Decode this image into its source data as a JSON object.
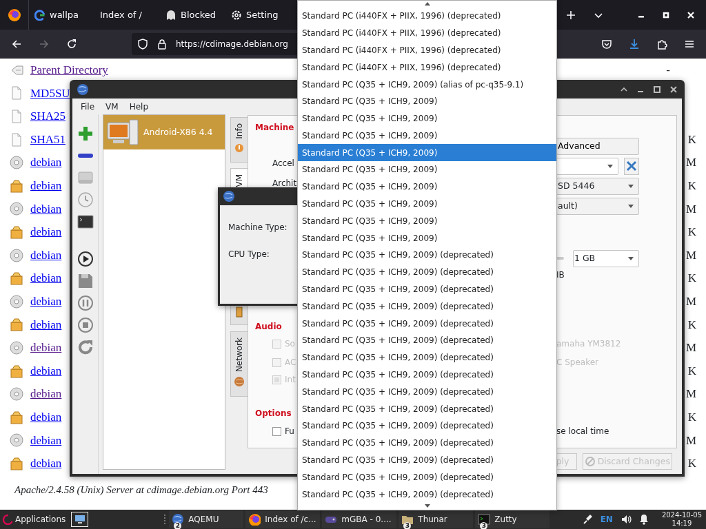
{
  "browser": {
    "tabs": [
      {
        "kind": "search",
        "label": "wallpa"
      },
      {
        "kind": "page",
        "label": "Index of /"
      },
      {
        "kind": "blocked",
        "label": "Blocked"
      },
      {
        "kind": "settings",
        "label": "Setting"
      }
    ],
    "url": "https://cdimage.debian.org"
  },
  "listing": {
    "rows": [
      {
        "kind": "parent",
        "name": "Parent Directory",
        "visited": true,
        "size": "-"
      },
      {
        "kind": "text",
        "name": "MD5SU",
        "visited": false
      },
      {
        "kind": "text",
        "name": "SHA25",
        "visited": false
      },
      {
        "kind": "text",
        "name": "SHA51",
        "visited": false,
        "size": "K"
      },
      {
        "kind": "disc",
        "name": "debian",
        "visited": false,
        "size": "M"
      },
      {
        "kind": "package",
        "name": "debian",
        "visited": false,
        "size": "K"
      },
      {
        "kind": "disc",
        "name": "debian",
        "visited": false,
        "size": "M"
      },
      {
        "kind": "package",
        "name": "debian",
        "visited": false,
        "size": "K"
      },
      {
        "kind": "disc",
        "name": "debian",
        "visited": false,
        "size": "M"
      },
      {
        "kind": "package",
        "name": "debian",
        "visited": false,
        "size": "K"
      },
      {
        "kind": "disc",
        "name": "debian",
        "visited": false,
        "size": "M"
      },
      {
        "kind": "package",
        "name": "debian",
        "visited": false,
        "size": "K"
      },
      {
        "kind": "disc",
        "name": "debian",
        "visited": true,
        "size": "M"
      },
      {
        "kind": "package",
        "name": "debian",
        "visited": false,
        "size": "K"
      },
      {
        "kind": "disc",
        "name": "debian",
        "visited": true,
        "size": "M"
      },
      {
        "kind": "package",
        "name": "debian",
        "visited": false,
        "size": "K"
      },
      {
        "kind": "disc",
        "name": "debian",
        "visited": false,
        "size": "M"
      },
      {
        "kind": "package",
        "name": "debian",
        "visited": false,
        "size": "K"
      }
    ],
    "footer": "Apache/2.4.58 (Unix) Server at cdimage.debian.org Port 443"
  },
  "qemu": {
    "menu": [
      "File",
      "VM",
      "Help"
    ],
    "toolbar": [
      {
        "kind": "add"
      },
      {
        "kind": "remove"
      },
      {
        "kind": "drive"
      },
      {
        "kind": "clock"
      },
      {
        "kind": "terminal"
      },
      {
        "kind": "play"
      },
      {
        "kind": "save"
      },
      {
        "kind": "pause"
      },
      {
        "kind": "stop"
      },
      {
        "kind": "reset"
      }
    ],
    "vms": [
      {
        "name": "Android-X86 4.4",
        "selected": true
      }
    ],
    "tabs": [
      {
        "kind": "info",
        "label": "Info",
        "selected": false
      },
      {
        "kind": "plain",
        "label": "VM",
        "selected": true
      },
      {
        "kind": "device",
        "selected": false
      },
      {
        "kind": "network",
        "label": "Network",
        "selected": false
      }
    ],
    "sections": [
      {
        "title": "Machine",
        "rows": [
          {
            "kind": "button",
            "value": "Advanced"
          },
          {
            "kind": "combo-tool",
            "label": "Accel"
          },
          {
            "kind": "combo",
            "label": "Archit",
            "value": "SD 5446"
          },
          {
            "kind": "combo",
            "value": "ault)"
          },
          {
            "kind": "slider-combo",
            "value": "1 GB"
          },
          {
            "kind": "note",
            "value": "IB"
          }
        ]
      },
      {
        "title": "Audio",
        "rows": [
          {
            "kind": "checks",
            "items": [
              {
                "label": "So",
                "checked": false,
                "disabled": true
              },
              {
                "label": "amaha YM3812",
                "disabled": true
              }
            ]
          },
          {
            "kind": "checks",
            "items": [
              {
                "label": "AC",
                "checked": false,
                "disabled": true
              },
              {
                "label": "C Speaker",
                "disabled": true
              }
            ]
          },
          {
            "kind": "checks",
            "items": [
              {
                "label": "Int",
                "checked": true,
                "disabled": true
              }
            ]
          }
        ]
      },
      {
        "title": "Options",
        "rows": [
          {
            "kind": "checks",
            "items": [
              {
                "label": "Fu",
                "checked": false,
                "disabled": false
              },
              {
                "label": "se local time",
                "disabled": false
              }
            ]
          }
        ]
      }
    ],
    "buttons": [
      {
        "label": "ply",
        "disabled": true
      },
      {
        "label": "Discard Changes",
        "disabled": true
      }
    ]
  },
  "dialog": {
    "labels": [
      "Machine Type:",
      "CPU Type:"
    ]
  },
  "dropdown": {
    "items": [
      {
        "label": "Standard PC (i440FX + PIIX, 1996) (deprecated)",
        "selected": false
      },
      {
        "label": "Standard PC (i440FX + PIIX, 1996) (deprecated)",
        "selected": false
      },
      {
        "label": "Standard PC (i440FX + PIIX, 1996) (deprecated)",
        "selected": false
      },
      {
        "label": "Standard PC (i440FX + PIIX, 1996) (deprecated)",
        "selected": false
      },
      {
        "label": "Standard PC (Q35 + ICH9, 2009) (alias of pc-q35-9.1)",
        "selected": false
      },
      {
        "label": "Standard PC (Q35 + ICH9, 2009)",
        "selected": false
      },
      {
        "label": "Standard PC (Q35 + ICH9, 2009)",
        "selected": false
      },
      {
        "label": "Standard PC (Q35 + ICH9, 2009)",
        "selected": false
      },
      {
        "label": "Standard PC (Q35 + ICH9, 2009)",
        "selected": true
      },
      {
        "label": "Standard PC (Q35 + ICH9, 2009)",
        "selected": false
      },
      {
        "label": "Standard PC (Q35 + ICH9, 2009)",
        "selected": false
      },
      {
        "label": "Standard PC (Q35 + ICH9, 2009)",
        "selected": false
      },
      {
        "label": "Standard PC (Q35 + ICH9, 2009)",
        "selected": false
      },
      {
        "label": "Standard PC (Q35 + ICH9, 2009)",
        "selected": false
      },
      {
        "label": "Standard PC (Q35 + ICH9, 2009) (deprecated)",
        "selected": false
      },
      {
        "label": "Standard PC (Q35 + ICH9, 2009) (deprecated)",
        "selected": false
      },
      {
        "label": "Standard PC (Q35 + ICH9, 2009) (deprecated)",
        "selected": false
      },
      {
        "label": "Standard PC (Q35 + ICH9, 2009) (deprecated)",
        "selected": false
      },
      {
        "label": "Standard PC (Q35 + ICH9, 2009) (deprecated)",
        "selected": false
      },
      {
        "label": "Standard PC (Q35 + ICH9, 2009) (deprecated)",
        "selected": false
      },
      {
        "label": "Standard PC (Q35 + ICH9, 2009) (deprecated)",
        "selected": false
      },
      {
        "label": "Standard PC (Q35 + ICH9, 2009) (deprecated)",
        "selected": false
      },
      {
        "label": "Standard PC (Q35 + ICH9, 2009) (deprecated)",
        "selected": false
      },
      {
        "label": "Standard PC (Q35 + ICH9, 2009) (deprecated)",
        "selected": false
      },
      {
        "label": "Standard PC (Q35 + ICH9, 2009) (deprecated)",
        "selected": false
      },
      {
        "label": "Standard PC (Q35 + ICH9, 2009) (deprecated)",
        "selected": false
      },
      {
        "label": "Standard PC (Q35 + ICH9, 2009) (deprecated)",
        "selected": false
      },
      {
        "label": "Standard PC (Q35 + ICH9, 2009) (deprecated)",
        "selected": false
      },
      {
        "label": "Standard PC (Q35 + ICH9, 2009) (deprecated)",
        "selected": false
      }
    ]
  },
  "taskbar": {
    "start": "Applications",
    "tasks": [
      {
        "kind": "emulator",
        "label": "AQEMU",
        "count": "2"
      },
      {
        "kind": "browser",
        "label": "Index of /c..."
      },
      {
        "kind": "game",
        "label": "mGBA - 0...."
      },
      {
        "kind": "files",
        "label": "Thunar",
        "count": "3"
      },
      {
        "kind": "terminal",
        "label": "Zutty",
        "count": "3"
      }
    ],
    "keyboard": "EN",
    "date": "2024-10-05",
    "time": "14:19"
  }
}
